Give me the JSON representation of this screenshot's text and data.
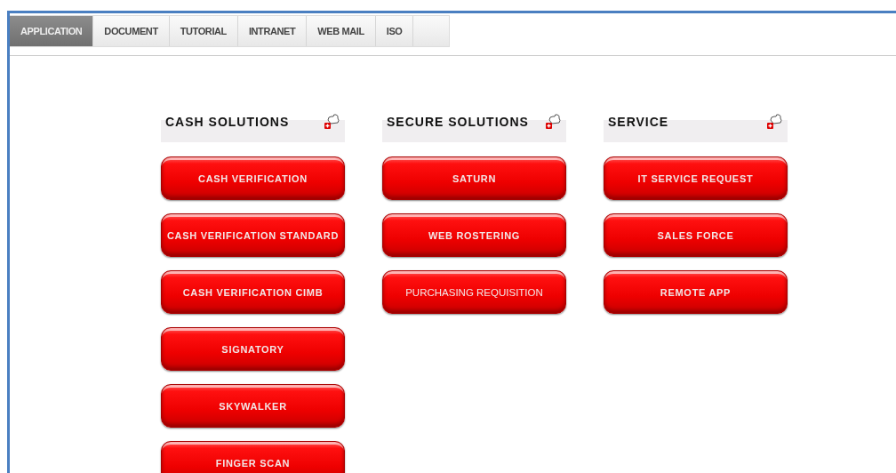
{
  "tabs": [
    {
      "label": "APPLICATION",
      "selected": true
    },
    {
      "label": "DOCUMENT",
      "selected": false
    },
    {
      "label": "TUTORIAL",
      "selected": false
    },
    {
      "label": "INTRANET",
      "selected": false
    },
    {
      "label": "WEB MAIL",
      "selected": false
    },
    {
      "label": "ISO",
      "selected": false
    }
  ],
  "sections": [
    {
      "title": "CASH SOLUTIONS",
      "buttons": [
        {
          "label": "CASH VERIFICATION",
          "kind": "bold"
        },
        {
          "label": "CASH VERIFICATION STANDARD",
          "kind": "bold"
        },
        {
          "label": "CASH VERIFICATION CIMB",
          "kind": "bold"
        },
        {
          "label": "SIGNATORY",
          "kind": "bold"
        },
        {
          "label": "SKYWALKER",
          "kind": "bold"
        },
        {
          "label": "FINGER SCAN",
          "kind": "bold"
        }
      ]
    },
    {
      "title": "SECURE SOLUTIONS",
      "buttons": [
        {
          "label": "SATURN",
          "kind": "bold"
        },
        {
          "label": "WEB ROSTERING",
          "kind": "bold"
        },
        {
          "label": "PURCHASING REQUISITION",
          "kind": "plain"
        }
      ]
    },
    {
      "title": "SERVICE",
      "buttons": [
        {
          "label": "IT SERVICE REQUEST",
          "kind": "bold"
        },
        {
          "label": "SALES FORCE",
          "kind": "bold"
        },
        {
          "label": "REMOTE APP",
          "kind": "bold"
        }
      ]
    }
  ]
}
